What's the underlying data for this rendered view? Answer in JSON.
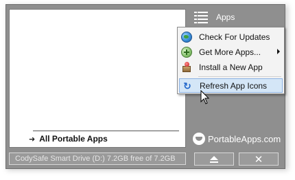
{
  "app_list": {
    "all_apps_label": "All Portable Apps"
  },
  "drive_bar": {
    "text": "CodySafe Smart Drive (D:) 7.2GB free of 7.2GB"
  },
  "header": {
    "apps_label": "Apps"
  },
  "menu": {
    "items": [
      {
        "label": "Check For Updates",
        "icon": "globe-update-icon"
      },
      {
        "label": "Get More Apps...",
        "icon": "green-plus-globe-icon",
        "has_submenu": true
      },
      {
        "label": "Install a New App",
        "icon": "package-install-icon"
      },
      {
        "label": "Refresh App Icons",
        "icon": "refresh-icon",
        "selected": true
      }
    ]
  },
  "brand": {
    "label": "PortableApps.com"
  },
  "buttons": {
    "close_glyph": "✕"
  },
  "colors": {
    "frame": "#8f8f8f",
    "selection": "#d4e6f7",
    "selection_border": "#8db2e3"
  }
}
